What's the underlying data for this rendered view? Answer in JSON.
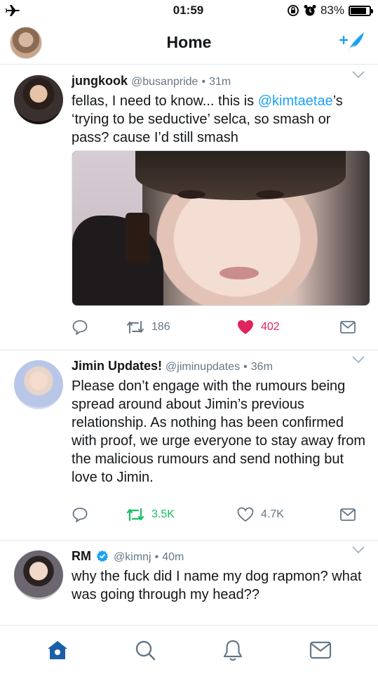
{
  "status_bar": {
    "time": "01:59",
    "battery_percent": "83%",
    "battery_level": 0.83,
    "left_icon": "airplane-icon",
    "right_icons": [
      "orientation-lock-icon",
      "alarm-icon",
      "battery-icon"
    ]
  },
  "nav": {
    "title": "Home",
    "compose_icon": "compose-tweet-icon"
  },
  "tweets": [
    {
      "name": "jungkook",
      "handle": "@busanpride",
      "time": "31m",
      "separator": "•",
      "text_parts": [
        "fellas, I need to know... this is ",
        "@kimtaetae",
        "’s ‘trying to be seductive’ selca, so smash or pass? cause I’d still smash"
      ],
      "has_media": true,
      "retweets": "186",
      "likes": "402",
      "liked": true,
      "retweeted": false
    },
    {
      "name": "Jimin Updates!",
      "handle": "@jiminupdates",
      "time": "36m",
      "separator": "•",
      "text": "Please don’t engage with the rumours being spread around about Jimin’s previous relationship. As nothing has been confirmed with proof, we urge everyone to stay away from the malicious rumours and send nothing but love to Jimin.",
      "retweets": "3.5K",
      "likes": "4.7K",
      "liked": false,
      "retweeted": true
    },
    {
      "name": "RM",
      "verified": true,
      "handle": "@kimnj",
      "time": "40m",
      "separator": "•",
      "text": "why the fuck did I name my dog rapmon? what was going through my head??"
    }
  ],
  "tab_bar": {
    "tabs": [
      "home-icon",
      "search-icon",
      "notifications-icon",
      "messages-icon"
    ],
    "active": "home-icon"
  },
  "colors": {
    "accent": "#1da1f2",
    "like": "#e0245e",
    "retweet": "#17bf63",
    "secondary_text": "#657786",
    "tab_active": "#1b5fa8"
  }
}
